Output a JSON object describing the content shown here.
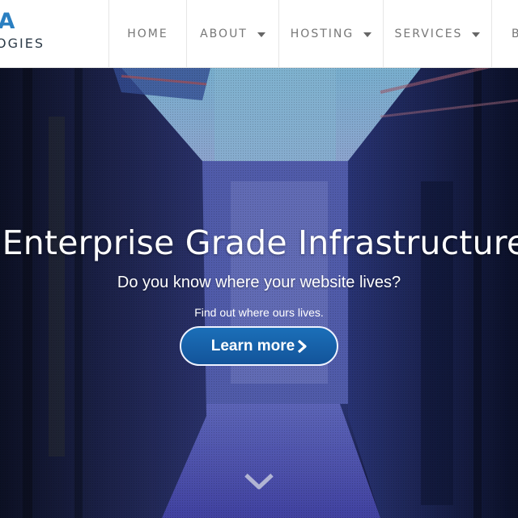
{
  "header": {
    "logo_main": "DATA",
    "logo_sub": "TECHNOLOGIES",
    "nav": [
      {
        "label": "HOME",
        "dropdown": false
      },
      {
        "label": "ABOUT",
        "dropdown": true
      },
      {
        "label": "HOSTING",
        "dropdown": true
      },
      {
        "label": "SERVICES",
        "dropdown": true
      },
      {
        "label": "B",
        "dropdown": false
      }
    ]
  },
  "hero": {
    "title": "Enterprise Grade Infrastructure",
    "subtitle": "Do you know where your website lives?",
    "tagline": "Find out where ours lives.",
    "button_label": "Learn more",
    "button_icon": "chevron-right-icon",
    "scroll_icon": "chevron-down-icon"
  },
  "colors": {
    "brand_blue": "#2a7fc1",
    "button_blue": "#1b6fb8",
    "nav_text": "#777777"
  }
}
